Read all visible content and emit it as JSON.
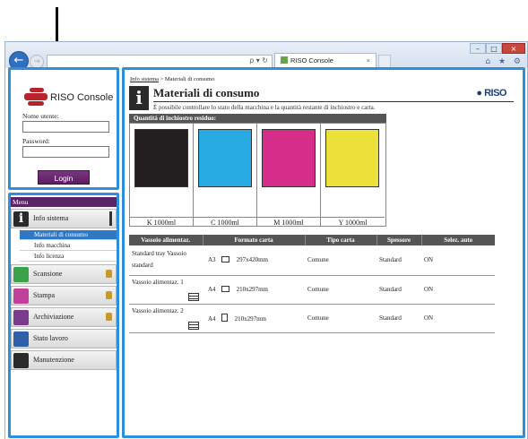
{
  "browser": {
    "tab_title": "RISO Console",
    "address_tools": "ρ ▾ ↻",
    "tab_close": "×",
    "win_min": "–",
    "win_max": "□",
    "win_close": "×",
    "toolbar_icons": "⌂ ★ ⚙"
  },
  "login": {
    "app_name": "RISO Console",
    "username_label": "Nome utente:",
    "username_value": "",
    "password_label": "Password:",
    "password_value": "",
    "login_button": "Login"
  },
  "menu": {
    "header": "Menu",
    "items": [
      {
        "label": "Info sistema",
        "icon": "info-icon",
        "selected": true
      },
      {
        "label": "Scansione",
        "icon": "scan-icon",
        "locked": true
      },
      {
        "label": "Stampa",
        "icon": "print-icon",
        "locked": true
      },
      {
        "label": "Archiviazione",
        "icon": "storage-icon",
        "locked": true
      },
      {
        "label": "Stato lavoro",
        "icon": "job-status-icon"
      },
      {
        "label": "Manutenzione",
        "icon": "maintenance-icon"
      }
    ],
    "subitems": [
      {
        "label": "Materiali di consumo",
        "active": true
      },
      {
        "label": "Info macchina"
      },
      {
        "label": "Info licenza"
      }
    ]
  },
  "main": {
    "breadcrumb_link": "Info sistema",
    "breadcrumb_sep": " > ",
    "breadcrumb_current": "Materiali di consumo",
    "page_title": "Materiali di consumo",
    "description": "È possibile controllare lo stato della macchina e la quantità restante di inchiostro e carta.",
    "brand": "RISO",
    "ink_section_title": "Quantità di inchiostro residuo:",
    "inks": [
      {
        "label": "K 1000ml",
        "color": "#231f20"
      },
      {
        "label": "C 1000ml",
        "color": "#27aae1"
      },
      {
        "label": "M 1000ml",
        "color": "#d62d8a"
      },
      {
        "label": "Y 1000ml",
        "color": "#ece13a"
      }
    ],
    "tray_headers": [
      "Vassoio alimentaz.",
      "Formato carta",
      "Tipo carta",
      "Spessore",
      "Selez. auto"
    ],
    "trays": [
      {
        "name": "Standard tray Vassoio standard",
        "size": "A3",
        "dims": "297x420mm",
        "type": "Comune",
        "thickness": "Standard",
        "auto": "ON"
      },
      {
        "name": "Vassoio alimentaz. 1",
        "size": "A4",
        "dims": "210x297mm",
        "type": "Comune",
        "thickness": "Standard",
        "auto": "ON"
      },
      {
        "name": "Vassoio alimentaz. 2",
        "size": "A4",
        "dims": "210x297mm",
        "type": "Comune",
        "thickness": "Standard",
        "auto": "ON"
      }
    ]
  }
}
